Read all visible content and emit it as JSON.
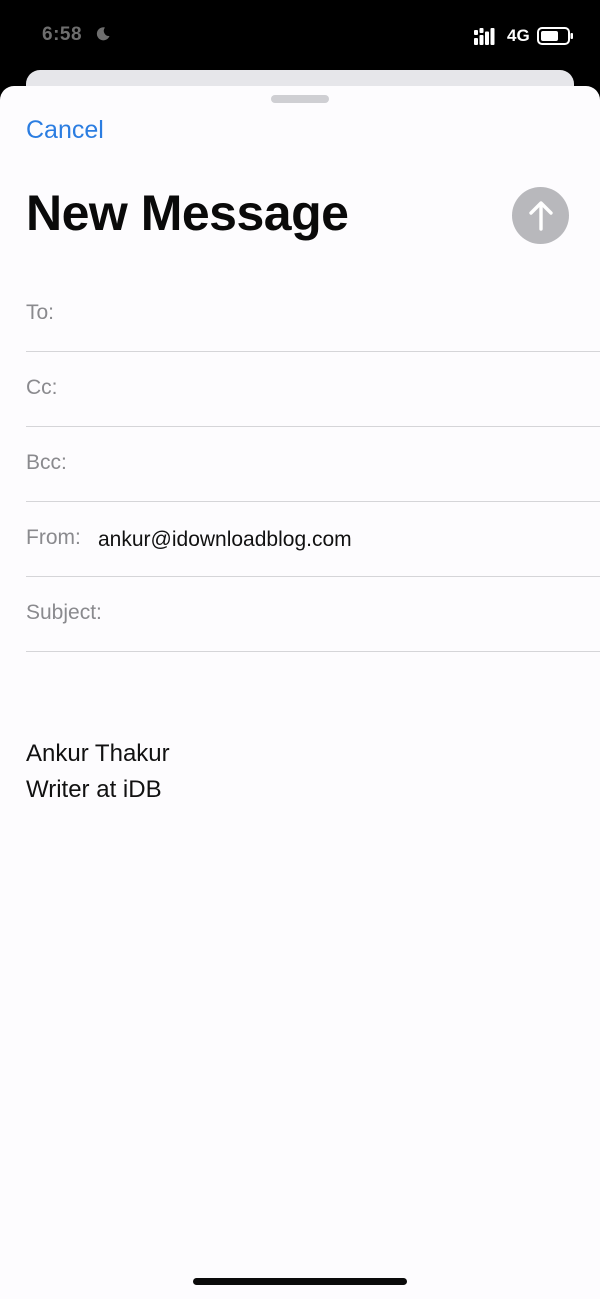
{
  "status_bar": {
    "time": "6:58",
    "network": "4G",
    "icons": [
      "moon-icon",
      "signal-icon",
      "battery-icon"
    ]
  },
  "header": {
    "cancel_label": "Cancel",
    "title": "New Message",
    "send_icon": "arrow-up-icon"
  },
  "fields": {
    "to_label": "To:",
    "to_value": "",
    "cc_label": "Cc:",
    "cc_value": "",
    "bcc_label": "Bcc:",
    "bcc_value": "",
    "from_label": "From:",
    "from_value": "ankur@idownloadblog.com",
    "subject_label": "Subject:",
    "subject_value": ""
  },
  "body": {
    "signature_lines": [
      "Ankur Thakur",
      "Writer at iDB"
    ]
  },
  "colors": {
    "accent": "#2b7de1",
    "send_disabled": "#b8b8bc",
    "label_gray": "#8a8a8e"
  }
}
